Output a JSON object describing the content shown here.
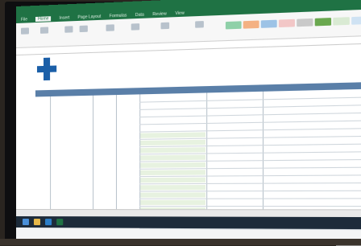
{
  "window": {
    "title": "",
    "ribbon_tabs": [
      "File",
      "Home",
      "Insert",
      "Page Layout",
      "Formulas",
      "Data",
      "Review",
      "View"
    ],
    "active_tab": "Home"
  },
  "formula_bar": {
    "name_box": "",
    "value": ""
  },
  "header": {
    "org_line1": "",
    "org_line2": "",
    "org_short": "",
    "doc_title_lines": [
      "",
      "",
      ""
    ]
  },
  "table": {
    "columns": [
      "",
      "",
      "",
      "",
      "",
      ""
    ],
    "rows_visible": 18
  },
  "statusbar": {
    "sheet_tab": ""
  },
  "colors": {
    "excel_green": "#1f7244",
    "header_blue": "#5a7fa8",
    "logo_blue": "#1b5fa8",
    "ribbon_styles": [
      "#8fd0a8",
      "#f4b183",
      "#9dc3e6",
      "#f2c7c7",
      "#c9c9c9",
      "#6aa84f",
      "#d9ead3",
      "#cfe2f3"
    ]
  }
}
